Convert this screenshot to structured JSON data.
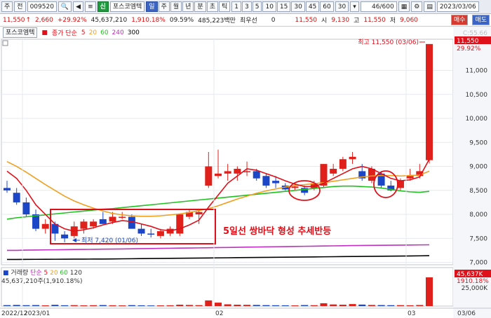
{
  "toolbar": {
    "market": "주",
    "prefix": "전",
    "code": "009520",
    "sin_badge": "신",
    "stock_name": "포스코엠텍",
    "periods": [
      "일",
      "주",
      "월",
      "년",
      "분",
      "초",
      "틱"
    ],
    "active_period": "일",
    "intervals": [
      "1",
      "3",
      "5",
      "10",
      "15",
      "30",
      "45",
      "60"
    ],
    "count": "30",
    "page": "46",
    "total": "/600",
    "date": "2023/03/06",
    "buy_label": "매수",
    "sell_label": "매도"
  },
  "quote": {
    "price": "11,550",
    "change": "2,660",
    "change_pct": "+29.92%",
    "volume": "45,637,210",
    "volume_ratio": "1,910.18%",
    "turnover": "09.59%",
    "amount": "485,223백만",
    "pref_label": "최우선",
    "pref_value": "0",
    "pref_price": "11,550",
    "open_label": "시",
    "open": "9,130",
    "high_label": "고",
    "high": "11,550",
    "low_label": "저",
    "low": "9,060"
  },
  "chart": {
    "name": "포스코엠텍",
    "ma_label": "종가 단순",
    "ma_periods": [
      "5",
      "20",
      "60",
      "240",
      "300"
    ],
    "ma_colors": [
      "#e0101a",
      "#f0a020",
      "#20c020",
      "#c030c0",
      "#000000"
    ],
    "high_marker": "최고 11,550 (03/06)",
    "low_marker": "최저 7,420 (01/06)",
    "annotation": "5일선 쌍바닥 형성 추세반등",
    "right_top_1": "C:55.66",
    "right_top_2": "11,550",
    "right_top_3": "29.92%",
    "price_ticks": [
      "11,000",
      "10,500",
      "10,000",
      "9,500",
      "9,000",
      "8,500",
      "8,000",
      "7,500",
      "7,000"
    ],
    "volume_label": "거래량",
    "volume_ma_label": "단순",
    "volume_ma_periods": [
      "5",
      "20",
      "60",
      "120"
    ],
    "volume_value": "45,637,210주(1,910.18%)",
    "volume_right_1": "45,637K",
    "volume_right_2": "1910.18%",
    "volume_tick": "25,000K",
    "x_labels": [
      "2022/12",
      "2023/01",
      "02",
      "03",
      "03/06"
    ]
  },
  "chart_data": {
    "type": "candlestick",
    "y_range": [
      6950,
      11650
    ],
    "volume_range": [
      0,
      50000
    ],
    "candles": [
      {
        "o": 8550,
        "h": 8700,
        "l": 8450,
        "c": 8500
      },
      {
        "o": 8450,
        "h": 8550,
        "l": 8200,
        "c": 8250
      },
      {
        "o": 8250,
        "h": 8350,
        "l": 7950,
        "c": 8000
      },
      {
        "o": 8000,
        "h": 8100,
        "l": 7650,
        "c": 7700
      },
      {
        "o": 7700,
        "h": 7900,
        "l": 7600,
        "c": 7800
      },
      {
        "o": 7800,
        "h": 7850,
        "l": 7450,
        "c": 7600
      },
      {
        "o": 7580,
        "h": 7650,
        "l": 7420,
        "c": 7500
      },
      {
        "o": 7550,
        "h": 7850,
        "l": 7500,
        "c": 7750
      },
      {
        "o": 7700,
        "h": 7900,
        "l": 7600,
        "c": 7850
      },
      {
        "o": 7750,
        "h": 7900,
        "l": 7700,
        "c": 7850
      },
      {
        "o": 7900,
        "h": 8050,
        "l": 7800,
        "c": 7800
      },
      {
        "o": 7850,
        "h": 8050,
        "l": 7800,
        "c": 7950
      },
      {
        "o": 7950,
        "h": 8050,
        "l": 7900,
        "c": 7950
      },
      {
        "o": 7950,
        "h": 8000,
        "l": 7700,
        "c": 7700
      },
      {
        "o": 7700,
        "h": 7800,
        "l": 7550,
        "c": 7600
      },
      {
        "o": 7600,
        "h": 7700,
        "l": 7520,
        "c": 7580
      },
      {
        "o": 7550,
        "h": 7700,
        "l": 7500,
        "c": 7650
      },
      {
        "o": 7600,
        "h": 7750,
        "l": 7550,
        "c": 7700
      },
      {
        "o": 7600,
        "h": 8000,
        "l": 7550,
        "c": 8000
      },
      {
        "o": 7950,
        "h": 8100,
        "l": 7900,
        "c": 8050
      },
      {
        "o": 8000,
        "h": 8100,
        "l": 7800,
        "c": 8050
      },
      {
        "o": 8600,
        "h": 9300,
        "l": 8550,
        "c": 9000
      },
      {
        "o": 8800,
        "h": 9350,
        "l": 8750,
        "c": 8850
      },
      {
        "o": 8850,
        "h": 9050,
        "l": 8700,
        "c": 8900
      },
      {
        "o": 8850,
        "h": 9000,
        "l": 8700,
        "c": 8950
      },
      {
        "o": 8900,
        "h": 9100,
        "l": 8800,
        "c": 8900
      },
      {
        "o": 8900,
        "h": 8950,
        "l": 8700,
        "c": 8750
      },
      {
        "o": 8800,
        "h": 8850,
        "l": 8550,
        "c": 8600
      },
      {
        "o": 8700,
        "h": 8800,
        "l": 8550,
        "c": 8650
      },
      {
        "o": 8600,
        "h": 8650,
        "l": 8500,
        "c": 8520
      },
      {
        "o": 8550,
        "h": 8650,
        "l": 8500,
        "c": 8580
      },
      {
        "o": 8550,
        "h": 8600,
        "l": 8400,
        "c": 8450
      },
      {
        "o": 8550,
        "h": 8700,
        "l": 8500,
        "c": 8650
      },
      {
        "o": 8600,
        "h": 9050,
        "l": 8550,
        "c": 9050
      },
      {
        "o": 8850,
        "h": 9050,
        "l": 8800,
        "c": 8950
      },
      {
        "o": 8950,
        "h": 9200,
        "l": 8900,
        "c": 9150
      },
      {
        "o": 9150,
        "h": 9300,
        "l": 9050,
        "c": 9200
      },
      {
        "o": 8900,
        "h": 9050,
        "l": 8700,
        "c": 8750
      },
      {
        "o": 8700,
        "h": 9000,
        "l": 8650,
        "c": 8950
      },
      {
        "o": 8850,
        "h": 8900,
        "l": 8550,
        "c": 8600
      },
      {
        "o": 8600,
        "h": 8700,
        "l": 8480,
        "c": 8500
      },
      {
        "o": 8550,
        "h": 8750,
        "l": 8500,
        "c": 8700
      },
      {
        "o": 8750,
        "h": 8950,
        "l": 8700,
        "c": 8800
      },
      {
        "o": 8800,
        "h": 9050,
        "l": 8750,
        "c": 8900
      },
      {
        "o": 9130,
        "h": 11550,
        "l": 9060,
        "c": 11550
      }
    ],
    "ma5": [
      8900,
      8750,
      8500,
      8200,
      8000,
      7800,
      7700,
      7650,
      7680,
      7720,
      7780,
      7830,
      7870,
      7850,
      7800,
      7750,
      7680,
      7660,
      7700,
      7780,
      7880,
      8150,
      8400,
      8650,
      8800,
      8950,
      8920,
      8850,
      8780,
      8700,
      8630,
      8580,
      8580,
      8650,
      8750,
      8850,
      8950,
      9000,
      8950,
      8850,
      8750,
      8700,
      8720,
      8780,
      9150
    ],
    "ma20": [
      9100,
      9000,
      8880,
      8750,
      8620,
      8500,
      8380,
      8280,
      8200,
      8130,
      8070,
      8020,
      7990,
      7970,
      7960,
      7960,
      7970,
      7990,
      8010,
      8040,
      8080,
      8120,
      8180,
      8250,
      8320,
      8380,
      8440,
      8490,
      8530,
      8570,
      8600,
      8620,
      8640,
      8660,
      8690,
      8720,
      8750,
      8780,
      8800,
      8810,
      8810,
      8800,
      8810,
      8820,
      8900
    ],
    "ma60": [
      7900,
      7930,
      7950,
      7970,
      7990,
      8010,
      8030,
      8050,
      8070,
      8090,
      8110,
      8120,
      8140,
      8160,
      8180,
      8200,
      8220,
      8240,
      8260,
      8280,
      8300,
      8320,
      8340,
      8360,
      8380,
      8400,
      8420,
      8440,
      8460,
      8480,
      8500,
      8520,
      8540,
      8560,
      8580,
      8590,
      8590,
      8580,
      8570,
      8550,
      8520,
      8490,
      8470,
      8460,
      8480
    ],
    "ma240": [
      7250,
      7250,
      7255,
      7258,
      7260,
      7262,
      7265,
      7268,
      7270,
      7272,
      7275,
      7278,
      7280,
      7283,
      7286,
      7289,
      7292,
      7295,
      7298,
      7300,
      7302,
      7305,
      7308,
      7311,
      7314,
      7317,
      7320,
      7323,
      7326,
      7329,
      7332,
      7335,
      7338,
      7341,
      7344,
      7347,
      7350,
      7352,
      7354,
      7356,
      7358,
      7360,
      7362,
      7364,
      7366
    ],
    "ma300": [
      7060,
      7061,
      7062,
      7063,
      7064,
      7065,
      7066,
      7067,
      7068,
      7069,
      7070,
      7072,
      7074,
      7076,
      7078,
      7080,
      7082,
      7084,
      7086,
      7088,
      7090,
      7092,
      7094,
      7096,
      7098,
      7100,
      7102,
      7104,
      7106,
      7108,
      7110,
      7112,
      7114,
      7116,
      7118,
      7120,
      7122,
      7124,
      7126,
      7128,
      7130,
      7132,
      7134,
      7136,
      7140
    ],
    "volumes": [
      1500,
      1800,
      1400,
      1600,
      1200,
      2000,
      1300,
      1500,
      1200,
      1400,
      1600,
      1300,
      1100,
      1500,
      1200,
      1000,
      1100,
      1300,
      2200,
      1800,
      1500,
      9000,
      5500,
      2800,
      2200,
      2000,
      1800,
      1500,
      1300,
      1200,
      1100,
      1600,
      1400,
      4500,
      2600,
      2200,
      3200,
      2400,
      1800,
      1600,
      1400,
      1500,
      1300,
      1700,
      45637
    ]
  }
}
